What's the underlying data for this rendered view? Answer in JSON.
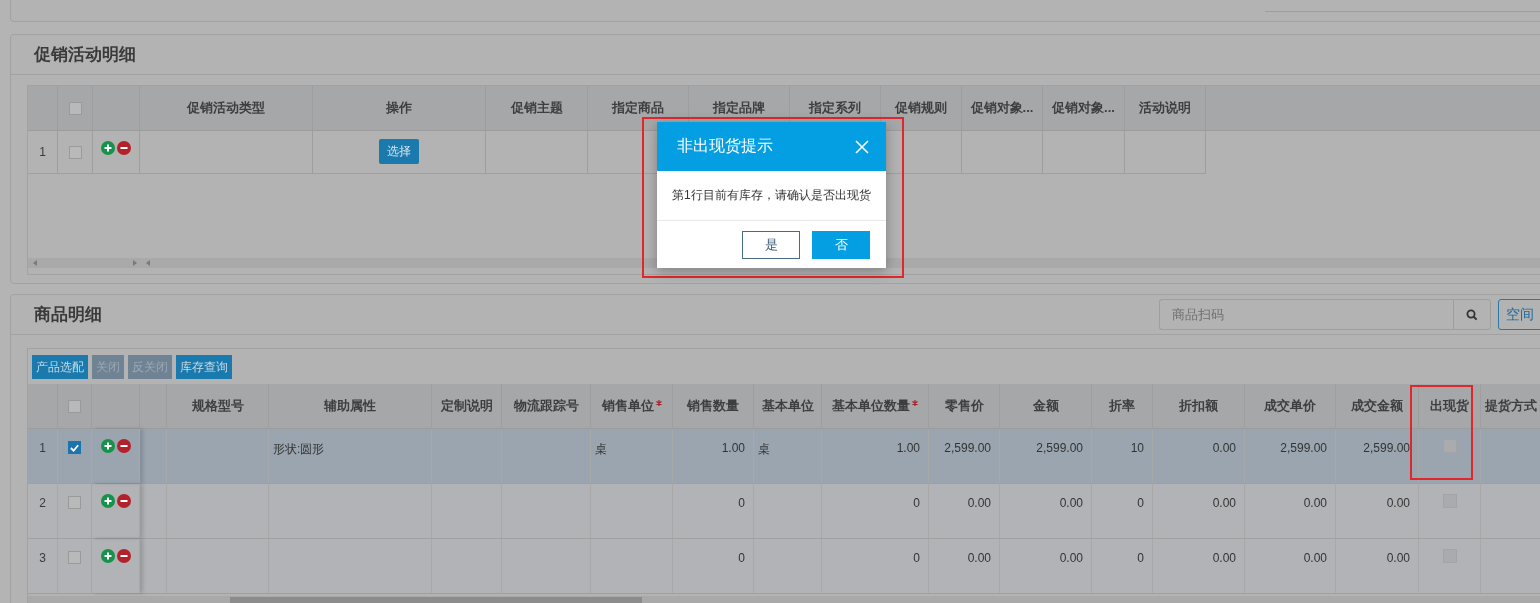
{
  "promotion_section": {
    "title": "促销活动明细",
    "header_checked": false,
    "columns": [
      {
        "label": "促销活动类型",
        "kind": "text"
      },
      {
        "label": "操作",
        "kind": "action"
      },
      {
        "label": "促销主题",
        "kind": "text"
      },
      {
        "label": "指定商品",
        "kind": "text"
      },
      {
        "label": "指定品牌",
        "kind": "text"
      },
      {
        "label": "指定系列",
        "kind": "text"
      },
      {
        "label": "促销规则",
        "kind": "text"
      },
      {
        "label": "促销对象...",
        "kind": "text"
      },
      {
        "label": "促销对象...",
        "kind": "text"
      },
      {
        "label": "活动说明",
        "kind": "text"
      }
    ],
    "rows": [
      {
        "number": "1",
        "checked": false,
        "action_button": "选择"
      }
    ]
  },
  "product_section": {
    "title": "商品明细",
    "search": {
      "placeholder": "商品扫码"
    },
    "side_button": "空间",
    "toolbar": [
      {
        "label": "产品选配",
        "disabled": false
      },
      {
        "label": "关闭",
        "disabled": true
      },
      {
        "label": "反关闭",
        "disabled": true
      },
      {
        "label": "库存查询",
        "disabled": false
      }
    ],
    "header_checked": false,
    "columns": [
      {
        "kind": "blank"
      },
      {
        "label": "规格型号",
        "kind": "text"
      },
      {
        "label": "辅助属性",
        "kind": "text"
      },
      {
        "label": "定制说明",
        "kind": "text"
      },
      {
        "label": "物流跟踪号",
        "kind": "text"
      },
      {
        "label": "销售单位",
        "kind": "text",
        "required": true
      },
      {
        "label": "销售数量",
        "kind": "number"
      },
      {
        "label": "基本单位",
        "kind": "text"
      },
      {
        "label": "基本单位数量",
        "kind": "number",
        "required": true
      },
      {
        "label": "零售价",
        "kind": "number"
      },
      {
        "label": "金额",
        "kind": "number"
      },
      {
        "label": "折率",
        "kind": "number"
      },
      {
        "label": "折扣额",
        "kind": "number"
      },
      {
        "label": "成交单价",
        "kind": "number"
      },
      {
        "label": "成交金额",
        "kind": "number"
      },
      {
        "label": "出现货",
        "kind": "checkbox",
        "highlighted": true
      },
      {
        "label": "提货方式",
        "kind": "text"
      }
    ],
    "rows": [
      {
        "number": "1",
        "selected": true,
        "checked": true,
        "cells": [
          null,
          null,
          "形状:圆形",
          null,
          null,
          "桌",
          "1.00",
          "桌",
          "1.00",
          "2,599.00",
          "2,599.00",
          "10",
          "0.00",
          "2,599.00",
          "2,599.00",
          false,
          null
        ]
      },
      {
        "number": "2",
        "selected": false,
        "checked": false,
        "cells": [
          null,
          null,
          null,
          null,
          null,
          null,
          "0",
          null,
          "0",
          "0.00",
          "0.00",
          "0",
          "0.00",
          "0.00",
          "0.00",
          false,
          null
        ]
      },
      {
        "number": "3",
        "selected": false,
        "checked": false,
        "cells": [
          null,
          null,
          null,
          null,
          null,
          null,
          "0",
          null,
          "0",
          "0.00",
          "0.00",
          "0",
          "0.00",
          "0.00",
          "0.00",
          false,
          null
        ]
      }
    ]
  },
  "dialog": {
    "title": "非出现货提示",
    "message": "第1行目前有库存，请确认是否出现货",
    "buttons": [
      {
        "label": "是",
        "kind": "secondary"
      },
      {
        "label": "否",
        "kind": "primary"
      }
    ],
    "highlighted": true
  }
}
